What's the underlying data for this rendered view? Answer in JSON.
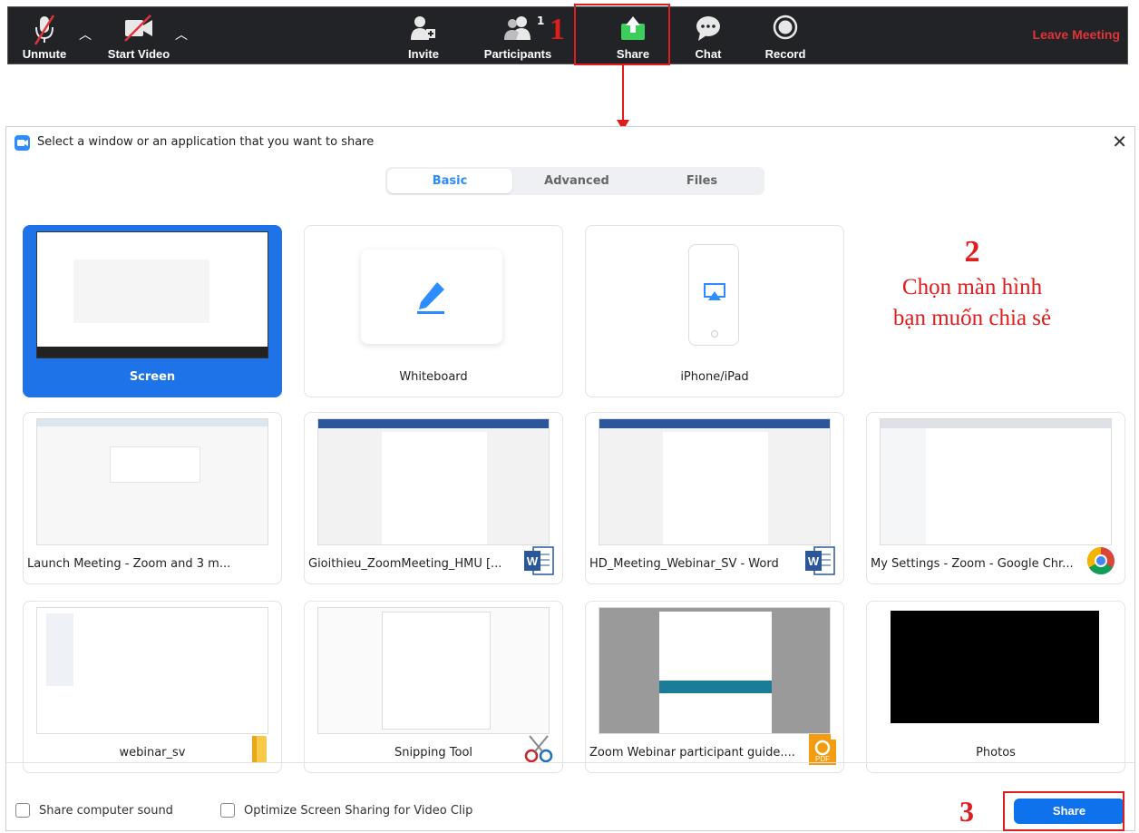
{
  "toolbar": {
    "unmute": "Unmute",
    "start_video": "Start Video",
    "invite": "Invite",
    "participants": "Participants",
    "participants_count": "1",
    "share": "Share",
    "chat": "Chat",
    "record": "Record",
    "leave": "Leave Meeting"
  },
  "annotations": {
    "step1": "1",
    "step2": "2",
    "step2_line1": "Chọn màn hình",
    "step2_line2": "bạn muốn chia sẻ",
    "step3": "3"
  },
  "dialog": {
    "title": "Select a window or an application that you want to share",
    "tabs": [
      "Basic",
      "Advanced",
      "Files"
    ],
    "tiles": [
      {
        "label": "Screen"
      },
      {
        "label": "Whiteboard"
      },
      {
        "label": "iPhone/iPad"
      },
      {
        "label": "Launch Meeting - Zoom and 3 m..."
      },
      {
        "label": "Gioithieu_ZoomMeeting_HMU [..."
      },
      {
        "label": "HD_Meeting_Webinar_SV - Word"
      },
      {
        "label": "My Settings - Zoom - Google Chr..."
      },
      {
        "label": "webinar_sv"
      },
      {
        "label": "Snipping Tool"
      },
      {
        "label": "Zoom Webinar participant guide...."
      },
      {
        "label": "Photos"
      }
    ],
    "share_sound": "Share computer sound",
    "optimize": "Optimize Screen Sharing for Video Clip",
    "share_button": "Share",
    "word_badge": "W",
    "pdf_badge": "PDF"
  }
}
